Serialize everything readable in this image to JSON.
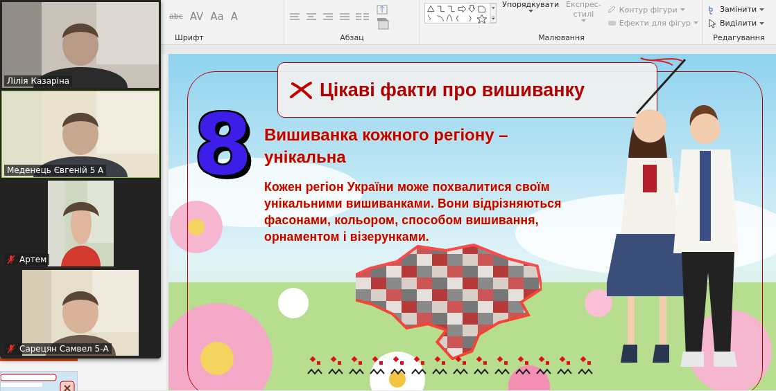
{
  "ribbon": {
    "groups": [
      {
        "kind": "font",
        "label": "Шрифт",
        "tools": [
          {
            "text": "abc",
            "disabled": true
          },
          {
            "text": "AV",
            "disabled": true
          },
          {
            "text": "Aa",
            "disabled": true
          },
          {
            "text": "A",
            "disabled": true
          }
        ]
      },
      {
        "kind": "paragraph",
        "label": "Абзац"
      },
      {
        "kind": "drawing",
        "label": "Малювання",
        "buttons": [
          {
            "kind": "large",
            "lines": [
              "Упорядкувати"
            ],
            "disabled": false
          },
          {
            "kind": "large",
            "lines": [
              "Експрес-",
              "стилі"
            ],
            "disabled": true
          },
          {
            "kind": "small",
            "lines": [
              "Контур фігури"
            ],
            "disabled": true
          },
          {
            "kind": "small",
            "lines": [
              "Ефекти для фігур"
            ],
            "disabled": true
          }
        ]
      },
      {
        "kind": "editing",
        "label": "Редагування",
        "buttons": [
          {
            "lines": [
              "Замінити"
            ],
            "disabled": false
          },
          {
            "lines": [
              "Виділити"
            ],
            "disabled": false
          }
        ]
      }
    ]
  },
  "video_gallery": {
    "participants": [
      {
        "name": "Лілія Казаріна",
        "muted": false,
        "active": false
      },
      {
        "name": "Меденець Євгеній 5 А",
        "muted": false,
        "active": true
      },
      {
        "name": "Артем",
        "muted": true,
        "active": false
      },
      {
        "name": "Сарецян Самвел 5-А",
        "muted": true,
        "active": false
      }
    ]
  },
  "slide": {
    "title": "Цікаві факти про вишиванку",
    "number": "8",
    "heading": "Вишиванка кожного регіону – унікальна",
    "body": "Кожен регіон України може похвалитися своїм унікальними вишиванками. Вони відрізняються фасонами, кольором, способом вишивання, орнаментом і візерунками."
  }
}
